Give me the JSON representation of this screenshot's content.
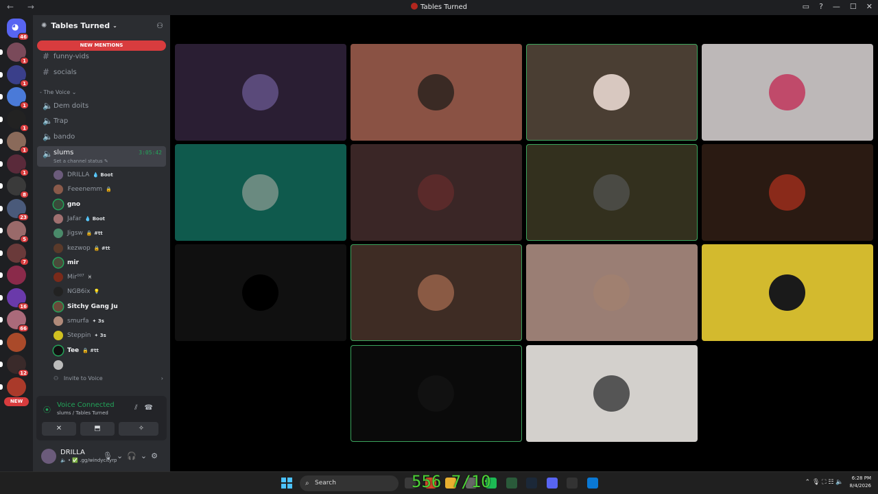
{
  "window": {
    "title": "Tables Turned",
    "nav": "← →"
  },
  "window_controls": [
    "▭",
    "?",
    "—",
    "☐",
    "✕"
  ],
  "rail": {
    "home_badge": "46",
    "servers": [
      {
        "color": "#7a4a5a",
        "badge": "1"
      },
      {
        "color": "#3a3f8a",
        "badge": "1"
      },
      {
        "color": "#4a7ad8",
        "badge": "1"
      },
      {
        "color": "#222222",
        "badge": "1"
      },
      {
        "color": "#8a6a5a",
        "badge": "1"
      },
      {
        "color": "#5a2a3a",
        "badge": "1"
      },
      {
        "color": "#3a3a3a",
        "badge": "8"
      },
      {
        "color": "#4a5a7a",
        "badge": "23"
      },
      {
        "color": "#9a6a6a",
        "badge": "5"
      },
      {
        "color": "#6a3a3a",
        "badge": "7"
      },
      {
        "color": "#8a2a4a",
        "badge": ""
      },
      {
        "color": "#6a3aaa",
        "badge": "16"
      },
      {
        "color": "#aa6a7a",
        "badge": "66"
      },
      {
        "color": "#aa4a2a",
        "badge": ""
      },
      {
        "color": "#3a2a2a",
        "badge": "12"
      },
      {
        "color": "#aa3a2a",
        "badge": ""
      }
    ],
    "new_label": "NEW"
  },
  "sidebar": {
    "server_name": "Tables Turned",
    "new_mentions": "NEW MENTIONS",
    "text_channels": [
      "funny-vids",
      "socials"
    ],
    "voice_category": "The Voice",
    "voice_channels": [
      "Dem doits",
      "Trap",
      "bando"
    ],
    "active_channel": {
      "name": "slums",
      "timer": "3:05:42",
      "status": "Set a channel status"
    },
    "members": [
      {
        "name": "DRILLA",
        "tag": "💧 Boot",
        "speaking": false,
        "color": "#6b5b7b"
      },
      {
        "name": "₣eeenemm",
        "tag": "🔒",
        "speaking": false,
        "color": "#8a5a4a"
      },
      {
        "name": "gno",
        "tag": "",
        "speaking": true,
        "color": "#3a4a3a"
      },
      {
        "name": "Jafar",
        "tag": "💧 Boot",
        "speaking": false,
        "color": "#a07070"
      },
      {
        "name": "Jigsw",
        "tag": "🔒 #tt",
        "speaking": false,
        "color": "#4a8a6a"
      },
      {
        "name": "kezwop",
        "tag": "🔒 #tt",
        "speaking": false,
        "color": "#5a3a2a"
      },
      {
        "name": "mir",
        "tag": "",
        "speaking": true,
        "color": "#4a4a3a"
      },
      {
        "name": "Mir⁰⁰⁷",
        "tag": "♓",
        "speaking": false,
        "color": "#7a2a1a"
      },
      {
        "name": "NGB6ix",
        "tag": "💡",
        "speaking": false,
        "color": "#222222"
      },
      {
        "name": "Sitchy Gang Ju",
        "tag": "",
        "speaking": true,
        "color": "#6a4a3a"
      },
      {
        "name": "smurfa",
        "tag": "✦ 3s",
        "speaking": false,
        "color": "#b08a7a"
      },
      {
        "name": "Steppin",
        "tag": "✦ 3s",
        "speaking": false,
        "color": "#d0c020"
      },
      {
        "name": "Tee",
        "tag": "🔒 #tt",
        "speaking": true,
        "color": "#111111"
      },
      {
        "name": "",
        "tag": "",
        "speaking": false,
        "color": "#bbbbbb"
      }
    ],
    "invite": "Invite to Voice"
  },
  "voice_panel": {
    "title": "Voice Connected",
    "subtitle": "slums / Tables Turned",
    "buttons": [
      "✕",
      "⬒",
      "✦",
      "✧"
    ]
  },
  "user": {
    "name": "DRILLA",
    "status": "🔈 • ✅ .gg/windycityrp"
  },
  "tiles": [
    {
      "bg": "#2a1e33",
      "avatar": "#5a4a7a",
      "speaking": false
    },
    {
      "bg": "#8a5244",
      "avatar": "#3a2a24",
      "speaking": false
    },
    {
      "bg": "#4a3e33",
      "avatar": "#d8c8c0",
      "speaking": true
    },
    {
      "bg": "#bdb8b8",
      "avatar": "#c04a6a",
      "speaking": false
    },
    {
      "bg": "#0f5a4d",
      "avatar": "#6a8a80",
      "speaking": false
    },
    {
      "bg": "#3a2626",
      "avatar": "#5a2a2a",
      "speaking": false
    },
    {
      "bg": "#33301e",
      "avatar": "#4a4a44",
      "speaking": true
    },
    {
      "bg": "#2a1a12",
      "avatar": "#8a2a1a",
      "speaking": false
    },
    {
      "bg": "#101010",
      "avatar": "#000000",
      "speaking": false
    },
    {
      "bg": "#3e2c24",
      "avatar": "#8a5a44",
      "speaking": true
    },
    {
      "bg": "#9a7e74",
      "avatar": "#a08070",
      "speaking": false
    },
    {
      "bg": "#d3ba2e",
      "avatar": "#1a1a1a",
      "speaking": false
    },
    {
      "bg": "#0a0a0a",
      "avatar": "#111111",
      "speaking": true
    },
    {
      "bg": "#d3d0cc",
      "avatar": "#555555",
      "speaking": false
    }
  ],
  "taskbar": {
    "search_placeholder": "Search",
    "overlay": "556 7/10",
    "apps": [
      "#3a3a3a",
      "#d04a2a",
      "#e8b030",
      "#666666",
      "#1db954",
      "#2a5a3a",
      "#1b2838",
      "#5865f2",
      "#333333",
      "#0a78d4"
    ],
    "tray": "⌃ 🎙 ⛶ ☷ 🔈",
    "time": "6:28 PM",
    "date": "8/4/2026"
  }
}
